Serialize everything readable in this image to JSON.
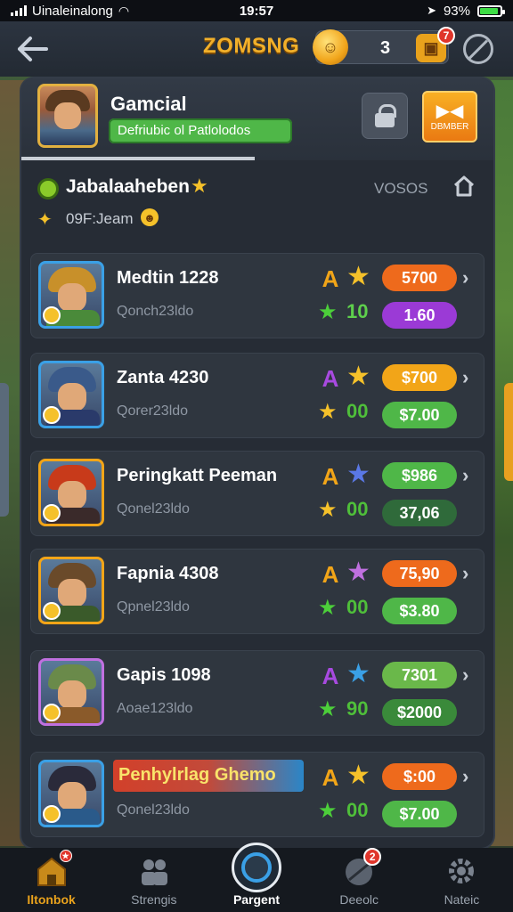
{
  "status_bar": {
    "carrier": "Uinaleinalong",
    "time": "19:57",
    "battery_percent": "93%",
    "battery_level": 0.93
  },
  "header": {
    "back_icon": "back-arrow-icon",
    "title": "ZOMSNG",
    "coin_count": "3",
    "bag_badge": "7",
    "no_icon": "block-icon"
  },
  "profile": {
    "name": "Gamcial",
    "tag": "Defriubic ol Patlolodos",
    "claim_label": "DBMBER"
  },
  "section": {
    "title": "Jabalaaheben",
    "code": "VOSOS",
    "subtitle": "09F:Jeam"
  },
  "rows": [
    {
      "name": "Medtin 1228",
      "sub": "Qonch23ldo",
      "badge_a": "A",
      "badge_a_color": "#f2a518",
      "star1": "★",
      "star1_color": "#f5c12a",
      "star2_color": "#4ccf3a",
      "num": "10",
      "top_value": "5700",
      "top_color": "#ee6a1c",
      "bottom_value": "1.60",
      "bottom_color": "#9b3ad6",
      "avatar_hair": "#c8902a",
      "avatar_body": "#4a8a3a",
      "avatar_border": "#3aa0e6"
    },
    {
      "name": "Zanta 4230",
      "sub": "Qorer23ldo",
      "badge_a": "A",
      "badge_a_color": "#a84ae0",
      "star1": "★",
      "star1_color": "#f5c12a",
      "star2_color": "#f5c12a",
      "num": "00",
      "top_value": "$700",
      "top_color": "#f2a518",
      "bottom_value": "$7.00",
      "bottom_color": "#4fb748",
      "avatar_hair": "#3a5a8a",
      "avatar_body": "#2a3a6a",
      "avatar_border": "#3aa0e6"
    },
    {
      "name": "Peringkatt Peeman",
      "sub": "Qonel23ldo",
      "badge_a": "A",
      "badge_a_color": "#f2a518",
      "star1": "★",
      "star1_color": "#5a78e6",
      "star2_color": "#f5c12a",
      "num": "00",
      "top_value": "$986",
      "top_color": "#4fb748",
      "bottom_value": "37,06",
      "bottom_color": "#2f6a3a",
      "avatar_hair": "#c83a1a",
      "avatar_body": "#3a2a2a",
      "avatar_border": "#f2a518"
    },
    {
      "name": "Fapnia 4308",
      "sub": "Qpnel23ldo",
      "badge_a": "A",
      "badge_a_color": "#f2a518",
      "star1": "★",
      "star1_color": "#c070e0",
      "star2_color": "#4ccf3a",
      "num": "00",
      "top_value": "75,90",
      "top_color": "#ee6a1c",
      "bottom_value": "$3.80",
      "bottom_color": "#4fb748",
      "avatar_hair": "#6a4a2a",
      "avatar_body": "#3a5a2a",
      "avatar_border": "#f2a518"
    },
    {
      "name": "Gapis 1098",
      "sub": "Aoae123ldo",
      "badge_a": "A",
      "badge_a_color": "#a84ae0",
      "star1": "★",
      "star1_color": "#3aa0e6",
      "star2_color": "#4ccf3a",
      "num": "90",
      "top_value": "7301",
      "top_color": "#6ab84a",
      "bottom_value": "$2000",
      "bottom_color": "#3a8a3a",
      "avatar_hair": "#6a8a4a",
      "avatar_body": "#8a5a2a",
      "avatar_border": "#c070e0"
    },
    {
      "name": "Penhylrlag Ghemo",
      "sub": "Qonel23ldo",
      "badge_a": "A",
      "badge_a_color": "#f2a518",
      "star1": "★",
      "star1_color": "#f5c12a",
      "star2_color": "#4ccf3a",
      "num": "00",
      "top_value": "$:00",
      "top_color": "#ee6a1c",
      "bottom_value": "$7.00",
      "bottom_color": "#4fb748",
      "avatar_hair": "#2a2a3a",
      "avatar_body": "#2a5a8a",
      "avatar_border": "#3aa0e6"
    }
  ],
  "nav": [
    {
      "label": "Iltonbok",
      "icon": "home-icon",
      "badge": ""
    },
    {
      "label": "Strengis",
      "icon": "people-icon",
      "badge": ""
    },
    {
      "label": "Pargent",
      "icon": "center-action-icon",
      "badge": ""
    },
    {
      "label": "Deeolc",
      "icon": "ball-icon",
      "badge": "2"
    },
    {
      "label": "Nateic",
      "icon": "gear-icon",
      "badge": ""
    }
  ],
  "colors": {
    "accent": "#f2b02a",
    "panel": "#262c35",
    "row": "#2f363f",
    "active_nav": "#e9a21c"
  }
}
